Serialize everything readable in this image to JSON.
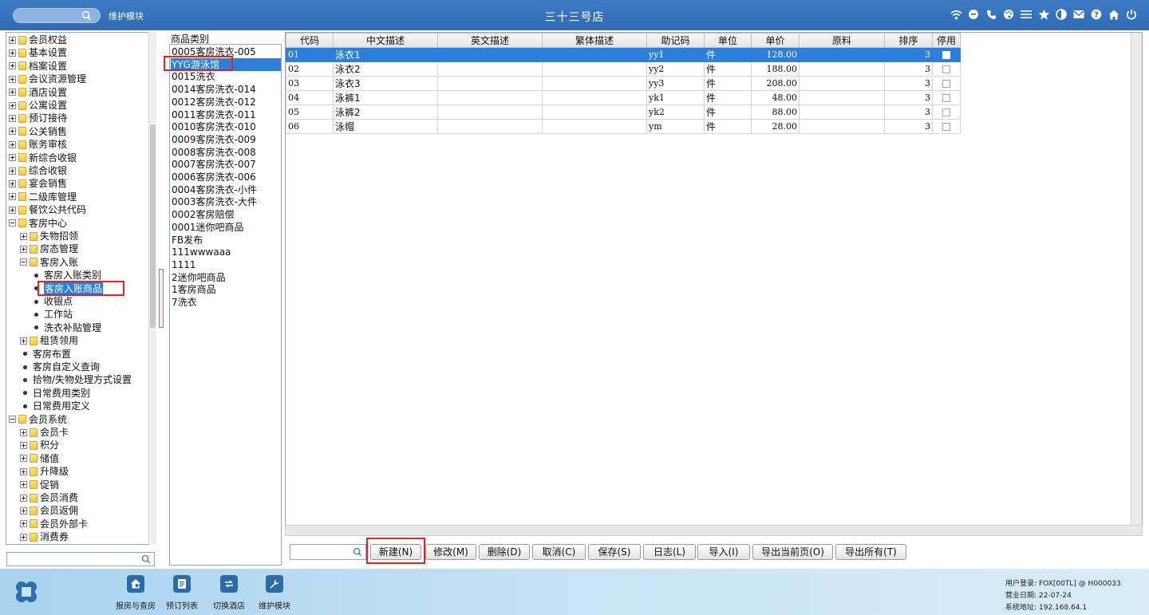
{
  "header": {
    "module_name": "维护模块",
    "hotel_title": "三十三号店",
    "icons": [
      "wifi-icon",
      "chat-icon",
      "phone-icon",
      "palette-icon",
      "menu-icon",
      "star-icon",
      "contrast-icon",
      "mail-icon",
      "help-icon",
      "home-icon",
      "power-icon"
    ]
  },
  "tree": {
    "items": [
      {
        "label": "会员权益",
        "level": 0,
        "kind": "folder",
        "expander": "plus"
      },
      {
        "label": "基本设置",
        "level": 0,
        "kind": "folder",
        "expander": "plus"
      },
      {
        "label": "档案设置",
        "level": 0,
        "kind": "folder",
        "expander": "plus"
      },
      {
        "label": "会议资源管理",
        "level": 0,
        "kind": "folder",
        "expander": "plus"
      },
      {
        "label": "酒店设置",
        "level": 0,
        "kind": "folder",
        "expander": "plus"
      },
      {
        "label": "公寓设置",
        "level": 0,
        "kind": "folder",
        "expander": "plus"
      },
      {
        "label": "预订接待",
        "level": 0,
        "kind": "folder",
        "expander": "plus"
      },
      {
        "label": "公关销售",
        "level": 0,
        "kind": "folder",
        "expander": "plus"
      },
      {
        "label": "账务审核",
        "level": 0,
        "kind": "folder",
        "expander": "plus"
      },
      {
        "label": "新综合收银",
        "level": 0,
        "kind": "folder",
        "expander": "plus"
      },
      {
        "label": "综合收银",
        "level": 0,
        "kind": "folder",
        "expander": "plus"
      },
      {
        "label": "宴会销售",
        "level": 0,
        "kind": "folder",
        "expander": "plus"
      },
      {
        "label": "二级库管理",
        "level": 0,
        "kind": "folder",
        "expander": "plus"
      },
      {
        "label": "餐饮公共代码",
        "level": 0,
        "kind": "folder",
        "expander": "plus"
      },
      {
        "label": "客房中心",
        "level": 0,
        "kind": "folder",
        "expander": "minus"
      },
      {
        "label": "失物招领",
        "level": 1,
        "kind": "folder",
        "expander": "plus"
      },
      {
        "label": "房态管理",
        "level": 1,
        "kind": "folder",
        "expander": "plus"
      },
      {
        "label": "客房入账",
        "level": 1,
        "kind": "folder",
        "expander": "minus"
      },
      {
        "label": "客房入账类别",
        "level": 2,
        "kind": "leaf"
      },
      {
        "label": "客房入账商品",
        "level": 2,
        "kind": "leaf",
        "selected": true
      },
      {
        "label": "收银点",
        "level": 2,
        "kind": "leaf"
      },
      {
        "label": "工作站",
        "level": 2,
        "kind": "leaf"
      },
      {
        "label": "洗衣补贴管理",
        "level": 2,
        "kind": "leaf"
      },
      {
        "label": "租赁领用",
        "level": 1,
        "kind": "folder",
        "expander": "plus"
      },
      {
        "label": "客房布置",
        "level": 1,
        "kind": "leaf"
      },
      {
        "label": "客房自定义查询",
        "level": 1,
        "kind": "leaf"
      },
      {
        "label": "拾物/失物处理方式设置",
        "level": 1,
        "kind": "leaf"
      },
      {
        "label": "日常费用类别",
        "level": 1,
        "kind": "leaf"
      },
      {
        "label": "日常费用定义",
        "level": 1,
        "kind": "leaf"
      },
      {
        "label": "会员系统",
        "level": 0,
        "kind": "folder",
        "expander": "minus"
      },
      {
        "label": "会员卡",
        "level": 1,
        "kind": "folder",
        "expander": "plus"
      },
      {
        "label": "积分",
        "level": 1,
        "kind": "folder",
        "expander": "plus"
      },
      {
        "label": "储值",
        "level": 1,
        "kind": "folder",
        "expander": "plus"
      },
      {
        "label": "升降级",
        "level": 1,
        "kind": "folder",
        "expander": "plus"
      },
      {
        "label": "促销",
        "level": 1,
        "kind": "folder",
        "expander": "plus"
      },
      {
        "label": "会员消费",
        "level": 1,
        "kind": "folder",
        "expander": "plus"
      },
      {
        "label": "会员返佣",
        "level": 1,
        "kind": "folder",
        "expander": "plus"
      },
      {
        "label": "会员外部卡",
        "level": 1,
        "kind": "folder",
        "expander": "plus"
      },
      {
        "label": "消费券",
        "level": 1,
        "kind": "folder",
        "expander": "plus"
      }
    ]
  },
  "categories": {
    "header": "商品类别",
    "items": [
      {
        "label": "0005客房洗衣-005"
      },
      {
        "label": "YYG游泳馆",
        "selected": true
      },
      {
        "label": "0015洗衣"
      },
      {
        "label": "0014客房洗衣-014"
      },
      {
        "label": "0012客房洗衣-012"
      },
      {
        "label": "0011客房洗衣-011"
      },
      {
        "label": "0010客房洗衣-010"
      },
      {
        "label": "0009客房洗衣-009"
      },
      {
        "label": "0008客房洗衣-008"
      },
      {
        "label": "0007客房洗衣-007"
      },
      {
        "label": "0006客房洗衣-006"
      },
      {
        "label": "0004客房洗衣-小件"
      },
      {
        "label": "0003客房洗衣-大件"
      },
      {
        "label": "0002客房赔偿"
      },
      {
        "label": "0001迷你吧商品"
      },
      {
        "label": "FB发布"
      },
      {
        "label": "111wwwaaa"
      },
      {
        "label": "1111"
      },
      {
        "label": "2迷你吧商品"
      },
      {
        "label": "1客房商品"
      },
      {
        "label": "7洗衣"
      }
    ]
  },
  "grid": {
    "columns": [
      "代码",
      "中文描述",
      "英文描述",
      "繁体描述",
      "助记码",
      "单位",
      "单价",
      "原料",
      "排序",
      "停用"
    ],
    "rows": [
      {
        "code": "01",
        "cn": "泳衣1",
        "en": "",
        "tw": "",
        "mnemonic": "yy1",
        "unit": "件",
        "price": "128.00",
        "material": "",
        "sort": "3",
        "disabled": false,
        "selected": true
      },
      {
        "code": "02",
        "cn": "泳衣2",
        "en": "",
        "tw": "",
        "mnemonic": "yy2",
        "unit": "件",
        "price": "188.00",
        "material": "",
        "sort": "3",
        "disabled": false
      },
      {
        "code": "03",
        "cn": "泳衣3",
        "en": "",
        "tw": "",
        "mnemonic": "yy3",
        "unit": "件",
        "price": "208.00",
        "material": "",
        "sort": "3",
        "disabled": false
      },
      {
        "code": "04",
        "cn": "泳裤1",
        "en": "",
        "tw": "",
        "mnemonic": "yk1",
        "unit": "件",
        "price": "48.00",
        "material": "",
        "sort": "3",
        "disabled": false
      },
      {
        "code": "05",
        "cn": "泳裤2",
        "en": "",
        "tw": "",
        "mnemonic": "yk2",
        "unit": "件",
        "price": "88.00",
        "material": "",
        "sort": "3",
        "disabled": false
      },
      {
        "code": "06",
        "cn": "泳帽",
        "en": "",
        "tw": "",
        "mnemonic": "ym",
        "unit": "件",
        "price": "28.00",
        "material": "",
        "sort": "3",
        "disabled": false
      }
    ]
  },
  "toolbar": {
    "buttons": [
      {
        "id": "new",
        "label": "新建(N)"
      },
      {
        "id": "edit",
        "label": "修改(M)"
      },
      {
        "id": "delete",
        "label": "删除(D)"
      },
      {
        "id": "cancel",
        "label": "取消(C)"
      },
      {
        "id": "save",
        "label": "保存(S)"
      },
      {
        "id": "log",
        "label": "日志(L)"
      },
      {
        "id": "import",
        "label": "导入(I)"
      },
      {
        "id": "export-page",
        "label": "导出当前页(O)"
      },
      {
        "id": "export-all",
        "label": "导出所有(T)"
      }
    ]
  },
  "footer": {
    "buttons": [
      {
        "id": "report",
        "label": "报房与查房",
        "icon": "house-icon"
      },
      {
        "id": "booking",
        "label": "预订列表",
        "icon": "list-icon"
      },
      {
        "id": "switch",
        "label": "切换酒店",
        "icon": "switch-icon"
      },
      {
        "id": "maint",
        "label": "维护模块",
        "icon": "wrench-icon"
      }
    ],
    "user_info": {
      "login_label": "用户登录:",
      "login_value": "FOX[00TL] @ H000033",
      "date_label": "营业日期:",
      "date_value": "22-07-24",
      "ip_label": "系统地址:",
      "ip_value": "192.168.64.1"
    }
  },
  "colors": {
    "header": "#3f7cc4",
    "selection": "#2e7fd9",
    "highlight_box": "#e32222"
  }
}
